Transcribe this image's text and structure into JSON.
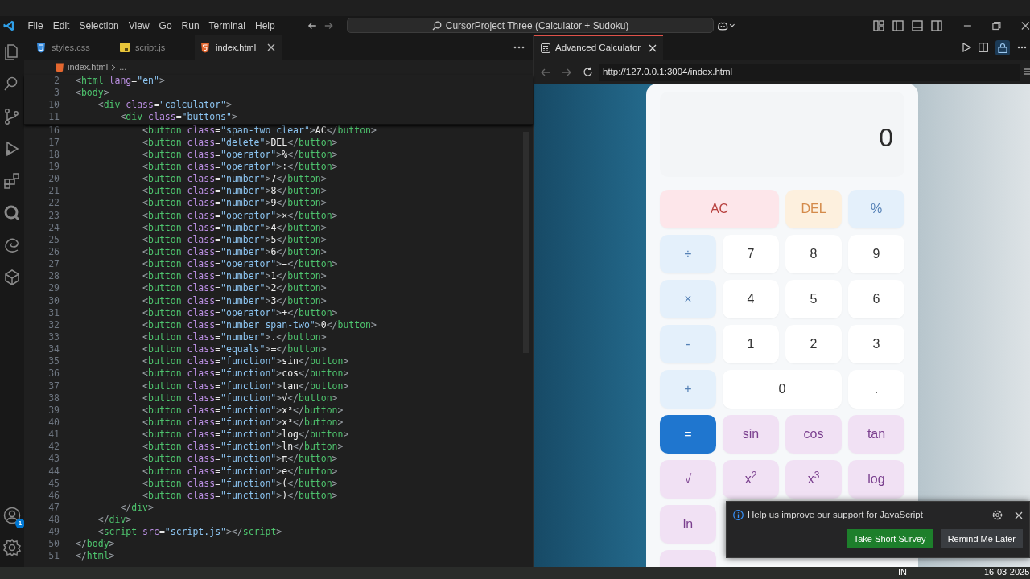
{
  "title_bar": {
    "menu": [
      "File",
      "Edit",
      "Selection",
      "View",
      "Go",
      "Run",
      "Terminal",
      "Help"
    ],
    "search": "CursorProject Three (Calculator + Sudoku)"
  },
  "activity_bar": {
    "accounts_badge": "1"
  },
  "editor": {
    "tabs": [
      {
        "label": "styles.css",
        "kind": "css",
        "selected": false
      },
      {
        "label": "script.js",
        "kind": "js",
        "selected": false
      },
      {
        "label": "index.html",
        "kind": "html",
        "selected": true
      }
    ],
    "breadcrumb": [
      "index.html",
      "..."
    ],
    "sticky_lines": [
      {
        "number": "2",
        "text": "<html lang=\"en\">"
      },
      {
        "number": "3",
        "text": "<body>"
      },
      {
        "number": "10",
        "text": "    <div class=\"calculator\">"
      },
      {
        "number": "11",
        "text": "        <div class=\"buttons\">"
      }
    ],
    "lines": [
      {
        "number": "16",
        "text": "            <button class=\"span-two clear\">AC</button>"
      },
      {
        "number": "17",
        "text": "            <button class=\"delete\">DEL</button>"
      },
      {
        "number": "18",
        "text": "            <button class=\"operator\">%</button>"
      },
      {
        "number": "19",
        "text": "            <button class=\"operator\">÷</button>"
      },
      {
        "number": "20",
        "text": "            <button class=\"number\">7</button>"
      },
      {
        "number": "21",
        "text": "            <button class=\"number\">8</button>"
      },
      {
        "number": "22",
        "text": "            <button class=\"number\">9</button>"
      },
      {
        "number": "23",
        "text": "            <button class=\"operator\">×</button>"
      },
      {
        "number": "24",
        "text": "            <button class=\"number\">4</button>"
      },
      {
        "number": "25",
        "text": "            <button class=\"number\">5</button>"
      },
      {
        "number": "26",
        "text": "            <button class=\"number\">6</button>"
      },
      {
        "number": "27",
        "text": "            <button class=\"operator\">−</button>"
      },
      {
        "number": "28",
        "text": "            <button class=\"number\">1</button>"
      },
      {
        "number": "29",
        "text": "            <button class=\"number\">2</button>"
      },
      {
        "number": "30",
        "text": "            <button class=\"number\">3</button>"
      },
      {
        "number": "31",
        "text": "            <button class=\"operator\">+</button>"
      },
      {
        "number": "32",
        "text": "            <button class=\"number span-two\">0</button>"
      },
      {
        "number": "33",
        "text": "            <button class=\"number\">.</button>"
      },
      {
        "number": "34",
        "text": "            <button class=\"equals\">=</button>"
      },
      {
        "number": "35",
        "text": "            <button class=\"function\">sin</button>"
      },
      {
        "number": "36",
        "text": "            <button class=\"function\">cos</button>"
      },
      {
        "number": "37",
        "text": "            <button class=\"function\">tan</button>"
      },
      {
        "number": "38",
        "text": "            <button class=\"function\">√</button>"
      },
      {
        "number": "39",
        "text": "            <button class=\"function\">x²</button>"
      },
      {
        "number": "40",
        "text": "            <button class=\"function\">x³</button>"
      },
      {
        "number": "41",
        "text": "            <button class=\"function\">log</button>"
      },
      {
        "number": "42",
        "text": "            <button class=\"function\">ln</button>"
      },
      {
        "number": "43",
        "text": "            <button class=\"function\">π</button>"
      },
      {
        "number": "44",
        "text": "            <button class=\"function\">e</button>"
      },
      {
        "number": "45",
        "text": "            <button class=\"function\">(</button>"
      },
      {
        "number": "46",
        "text": "            <button class=\"function\">)</button>"
      },
      {
        "number": "47",
        "text": "        </div>"
      },
      {
        "number": "48",
        "text": "    </div>"
      },
      {
        "number": "49",
        "text": "    <script src=\"script.js\"></script>"
      },
      {
        "number": "50",
        "text": "</body>"
      },
      {
        "number": "51",
        "text": "</html>"
      }
    ]
  },
  "browser": {
    "tab": "Advanced Calculator",
    "url": "http://127.0.0.1:3004/index.html",
    "calculator": {
      "display": "0",
      "keys": [
        {
          "label": "AC",
          "kind": "clear",
          "wide": true
        },
        {
          "label": "DEL",
          "kind": "delete"
        },
        {
          "label": "%",
          "kind": "operator"
        },
        {
          "label": "÷",
          "kind": "operator"
        },
        {
          "label": "7",
          "kind": "number"
        },
        {
          "label": "8",
          "kind": "number"
        },
        {
          "label": "9",
          "kind": "number"
        },
        {
          "label": "×",
          "kind": "operator"
        },
        {
          "label": "4",
          "kind": "number"
        },
        {
          "label": "5",
          "kind": "number"
        },
        {
          "label": "6",
          "kind": "number"
        },
        {
          "label": "-",
          "kind": "operator"
        },
        {
          "label": "1",
          "kind": "number"
        },
        {
          "label": "2",
          "kind": "number"
        },
        {
          "label": "3",
          "kind": "number"
        },
        {
          "label": "+",
          "kind": "operator"
        },
        {
          "label": "0",
          "kind": "number",
          "wide": true
        },
        {
          "label": ".",
          "kind": "number"
        },
        {
          "label": "=",
          "kind": "equals"
        },
        {
          "label": "sin",
          "kind": "function"
        },
        {
          "label": "cos",
          "kind": "function"
        },
        {
          "label": "tan",
          "kind": "function"
        },
        {
          "label": "√",
          "kind": "function"
        },
        {
          "label": "x$^{2}$",
          "kind": "function"
        },
        {
          "label": "x$^{3}$",
          "kind": "function"
        },
        {
          "label": "log",
          "kind": "function"
        },
        {
          "label": "ln",
          "kind": "function"
        },
        {
          "kind": "function"
        }
      ]
    }
  },
  "notification": {
    "message": "Help us improve our support for JavaScript",
    "actions": [
      {
        "label": "Take Short Survey",
        "primary": true
      },
      {
        "label": "Remind Me Later",
        "primary": false
      }
    ]
  },
  "taskbar": {
    "items": [
      "IN",
      "16-03-2025"
    ]
  }
}
